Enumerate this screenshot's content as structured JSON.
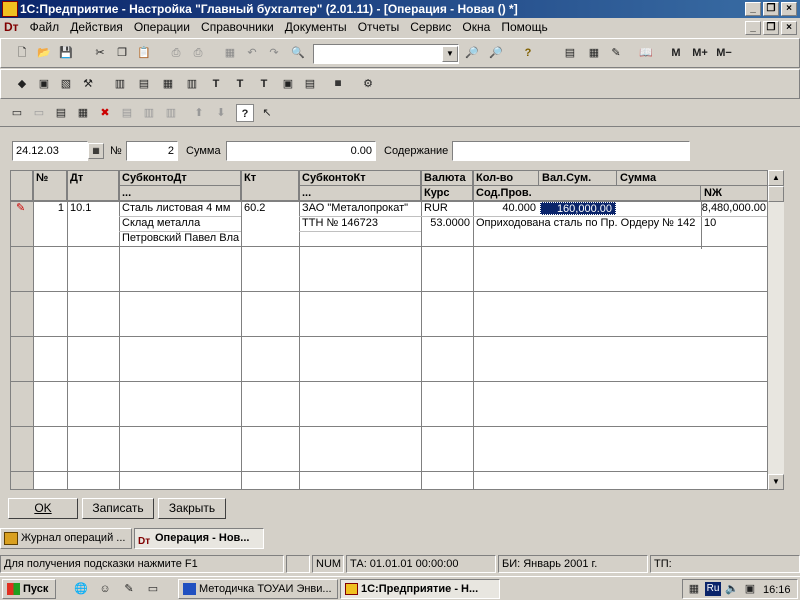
{
  "window": {
    "title": "1С:Предприятие - Настройка \"Главный бухгалтер\"  (2.01.11) - [Операция - Новая () *]"
  },
  "menu": {
    "items": [
      "Файл",
      "Действия",
      "Операции",
      "Справочники",
      "Документы",
      "Отчеты",
      "Сервис",
      "Окна",
      "Помощь"
    ]
  },
  "toolbar": {
    "m_label": "M",
    "mplus_label": "M+",
    "mminus_label": "M−",
    "combo_value": ""
  },
  "form": {
    "date": "24.12.03",
    "number_label": "№",
    "number": "2",
    "sum_label": "Сумма",
    "sum": "0.00",
    "content_label": "Содержание",
    "content": ""
  },
  "grid": {
    "headers": {
      "num": "№",
      "dt": "Дт",
      "subkonto_dt": "СубконтоДт",
      "subkonto_dt_sub": "...",
      "kt": "Кт",
      "subkonto_kt": "СубконтоКт",
      "subkonto_kt_sub": "...",
      "currency": "Валюта",
      "rate": "Курс",
      "qty": "Кол-во",
      "val_sum": "Вал.Сум.",
      "sum": "Сумма",
      "content": "Сод.Пров.",
      "nzh": "NЖ"
    },
    "row": {
      "num": "1",
      "dt": "10.1",
      "subkonto_dt": [
        "Сталь листовая 4 мм",
        "Склад металла",
        "Петровский Павел Вла"
      ],
      "kt": "60.2",
      "subkonto_kt": [
        "ЗАО \"Металопрокат\"",
        "ТТН № 146723"
      ],
      "currency": "RUR",
      "rate": "53.0000",
      "qty": "40.000",
      "val_sum": "160,000.00",
      "sum": "8,480,000.00",
      "content": "Оприходована сталь по Пр. Ордеру № 142",
      "nzh": "10"
    }
  },
  "buttons": {
    "ok": "OK",
    "save": "Записать",
    "close": "Закрыть"
  },
  "tabs": [
    {
      "label": "Журнал операций  ..."
    },
    {
      "label": "Операция - Нов..."
    }
  ],
  "status": {
    "hint": "Для получения подсказки нажмите F1",
    "num": "NUM",
    "ta": "ТА: 01.01.01  00:00:00",
    "bi": "БИ: Январь 2001 г.",
    "tp": "ТП:"
  },
  "taskbar": {
    "start": "Пуск",
    "apps": [
      "Методичка ТОУАИ Энви...",
      "1С:Предприятие - Н..."
    ],
    "lang": "Ru",
    "time": "16:16"
  },
  "colors": {
    "title_bar": "#0a246a",
    "window_bg": "#d4d0c8",
    "selection": "#0a246a"
  }
}
